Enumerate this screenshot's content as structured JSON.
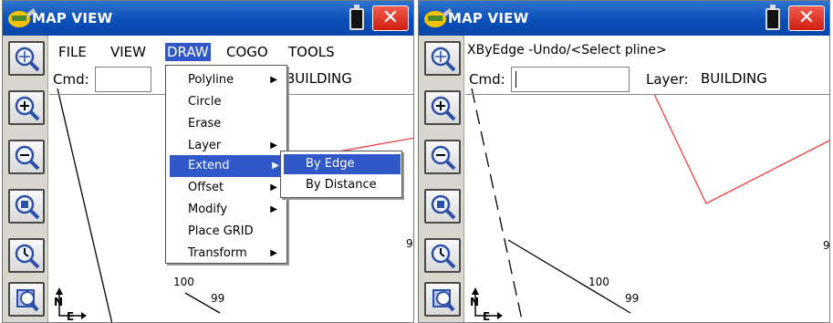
{
  "left": {
    "title": "MAP VIEW",
    "close_label": "✕",
    "menu": {
      "file": "FILE",
      "view": "VIEW",
      "draw": "DRAW",
      "cogo": "COGO",
      "tools": "TOOLS"
    },
    "cmd_label": "Cmd:",
    "layer_value": "BUILDING",
    "draw_menu": [
      {
        "label": "Polyline",
        "submenu": true
      },
      {
        "label": "Circle",
        "submenu": false
      },
      {
        "label": "Erase",
        "submenu": false
      },
      {
        "label": "Layer",
        "submenu": true
      },
      {
        "label": "Extend",
        "submenu": true
      },
      {
        "label": "Offset",
        "submenu": true
      },
      {
        "label": "Modify",
        "submenu": true
      },
      {
        "label": "Place GRID",
        "submenu": false
      },
      {
        "label": "Transform",
        "submenu": true
      }
    ],
    "extend_submenu": [
      "By Edge",
      "By Distance"
    ],
    "point_labels": {
      "p100": "100",
      "p99": "99",
      "edge": "9"
    },
    "north_label": "N",
    "east_label": "E"
  },
  "right": {
    "title": "MAP VIEW",
    "close_label": "✕",
    "prompt": "XByEdge -Undo/<Select pline>",
    "cmd_label": "Cmd:",
    "layer_label": "Layer:",
    "layer_value": "BUILDING",
    "point_labels": {
      "p100": "100",
      "p99": "99",
      "edge": "9"
    },
    "north_label": "N",
    "east_label": "E"
  },
  "colors": {
    "title_bar": "#0a4fb8",
    "close_button": "#d01d10",
    "menu_highlight": "#3058c9",
    "building_line": "#f04040"
  }
}
